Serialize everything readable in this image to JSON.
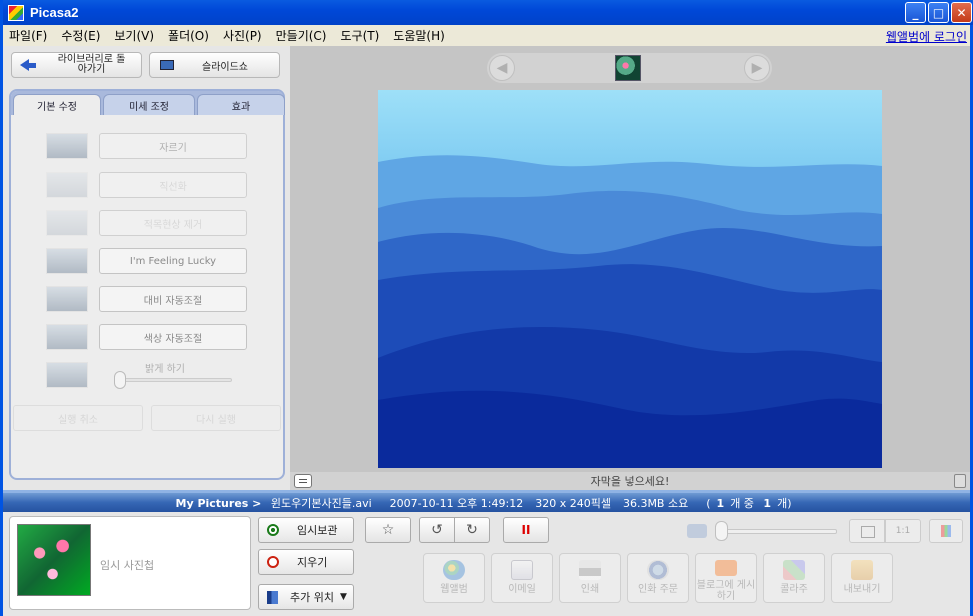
{
  "window": {
    "title": "Picasa2",
    "controls": {
      "minimize": "_",
      "maximize": "□",
      "close": "✕"
    }
  },
  "menu": {
    "items": [
      "파일(F)",
      "수정(E)",
      "보기(V)",
      "폴더(O)",
      "사진(P)",
      "만들기(C)",
      "도구(T)",
      "도움말(H)"
    ],
    "login_link": "웹앨범에 로그인"
  },
  "left_panel": {
    "back_button": "라이브러리로 돌아가기",
    "slideshow_button": "슬라이드쇼",
    "tabs": [
      {
        "label": "기본 수정",
        "active": true
      },
      {
        "label": "미세 조정",
        "active": false
      },
      {
        "label": "효과",
        "active": false
      }
    ],
    "fixes": {
      "crop": "자르기",
      "straighten": "직선화",
      "redeye": "적목현상 제거",
      "lucky": "I'm Feeling Lucky",
      "auto_contrast": "대비 자동조절",
      "auto_color": "색상 자동조절"
    },
    "fill_light_label": "밝게 하기",
    "fill_light_level": 0,
    "undo_button": "실행 취소",
    "redo_button": "다시 실행"
  },
  "viewer": {
    "prev_icon": "left-arrow-icon",
    "next_icon": "right-arrow-icon",
    "caption_placeholder": "자막을 넣으세요!"
  },
  "status": {
    "path_folder": "My Pictures >",
    "path_file": "윈도우기본사진들.avi",
    "datetime": "2007-10-11 오후 1:49:12",
    "dimensions": "320 x 240픽셀",
    "size": "36.3MB 소요",
    "count_prefix": "(",
    "count_a": "1",
    "count_mid": "개 중 ",
    "count_b": "1",
    "count_suffix": "개)"
  },
  "tray": {
    "label": "임시 사진첩",
    "hold_button": "임시보관",
    "clear_button": "지우기",
    "add_to_button": "추가 위치",
    "pause_label": "II",
    "actual_size_label": "1:1",
    "zoom_level": 0,
    "actions": {
      "web": "웹앨범",
      "email": "이메일",
      "print": "인쇄",
      "order": "인화 주문",
      "blog": "블로그에 게시하기",
      "collage": "콜라주",
      "export": "내보내기"
    }
  },
  "colors": {
    "titlebar": "#0048d8",
    "status_bar": "#3667b5",
    "photo_sky": "#8fd4f5",
    "photo_deep": "#0a2fa8"
  }
}
